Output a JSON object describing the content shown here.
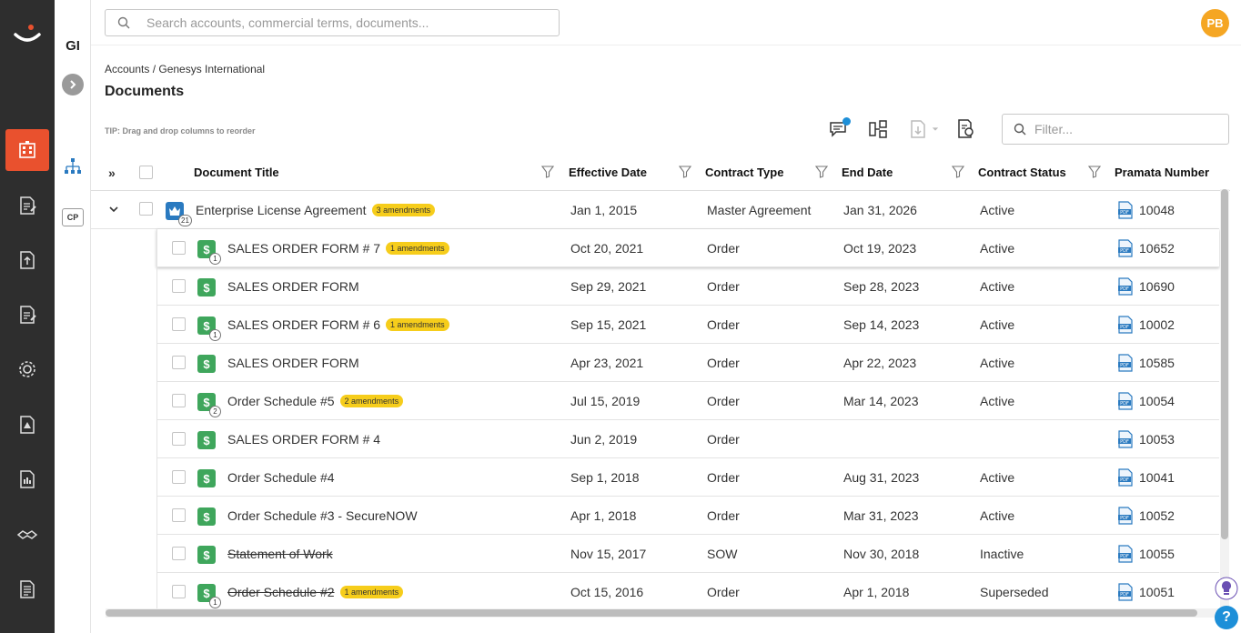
{
  "nav": {
    "items": [
      "logo-icon",
      "accounts-icon",
      "contract-edit-icon",
      "upload-document-icon",
      "document-edit-icon",
      "settings-gear-icon",
      "alert-document-icon",
      "report-document-icon",
      "handshake-icon",
      "list-document-icon"
    ],
    "accent": "#e9512e"
  },
  "subnav": {
    "account_initials": "GI",
    "cp_label": "CP"
  },
  "topbar": {
    "search_placeholder": "Search accounts, commercial terms, documents...",
    "user_initials": "PB"
  },
  "breadcrumb": "Accounts / Genesys International",
  "page_title": "Documents",
  "tip": "TIP: Drag and drop columns to reorder",
  "filter_placeholder": "Filter...",
  "columns": {
    "title": "Document Title",
    "effective": "Effective Date",
    "type": "Contract Type",
    "end": "End Date",
    "status": "Contract Status",
    "number": "Pramata Number"
  },
  "expand_all_label": "»",
  "rows": [
    {
      "title": "Enterprise License Agreement",
      "amend": "3 amendments",
      "count": "21",
      "effective": "Jan 1, 2015",
      "type": "Master Agreement",
      "end": "Jan 31, 2026",
      "status": "Active",
      "number": "10048"
    },
    {
      "title": "SALES ORDER FORM # 7",
      "amend": "1 amendments",
      "count": "1",
      "effective": "Oct 20, 2021",
      "type": "Order",
      "end": "Oct 19, 2023",
      "status": "Active",
      "number": "10652"
    },
    {
      "title": "SALES ORDER FORM",
      "amend": "",
      "count": "",
      "effective": "Sep 29, 2021",
      "type": "Order",
      "end": "Sep 28, 2023",
      "status": "Active",
      "number": "10690"
    },
    {
      "title": "SALES ORDER FORM # 6",
      "amend": "1 amendments",
      "count": "1",
      "effective": "Sep 15, 2021",
      "type": "Order",
      "end": "Sep 14, 2023",
      "status": "Active",
      "number": "10002"
    },
    {
      "title": "SALES ORDER FORM",
      "amend": "",
      "count": "",
      "effective": "Apr 23, 2021",
      "type": "Order",
      "end": "Apr 22, 2023",
      "status": "Active",
      "number": "10585"
    },
    {
      "title": "Order Schedule #5",
      "amend": "2 amendments",
      "count": "2",
      "effective": "Jul 15, 2019",
      "type": "Order",
      "end": "Mar 14, 2023",
      "status": "Active",
      "number": "10054"
    },
    {
      "title": "SALES ORDER FORM # 4",
      "amend": "",
      "count": "",
      "effective": "Jun 2, 2019",
      "type": "Order",
      "end": "",
      "status": "",
      "number": "10053"
    },
    {
      "title": "Order Schedule #4",
      "amend": "",
      "count": "",
      "effective": "Sep 1, 2018",
      "type": "Order",
      "end": "Aug 31, 2023",
      "status": "Active",
      "number": "10041"
    },
    {
      "title": "Order Schedule #3 - SecureNOW",
      "amend": "",
      "count": "",
      "effective": "Apr 1, 2018",
      "type": "Order",
      "end": "Mar 31, 2023",
      "status": "Active",
      "number": "10052"
    },
    {
      "title": "Statement of Work",
      "amend": "",
      "count": "",
      "effective": "Nov 15, 2017",
      "type": "SOW",
      "end": "Nov 30, 2018",
      "status": "Inactive",
      "number": "10055"
    },
    {
      "title": "Order Schedule #2",
      "amend": "1 amendments",
      "count": "1",
      "effective": "Oct 15, 2016",
      "type": "Order",
      "end": "Apr 1, 2018",
      "status": "Superseded",
      "number": "10051"
    }
  ],
  "icons": {
    "doc_symbol": "$",
    "help_symbol": "?"
  }
}
